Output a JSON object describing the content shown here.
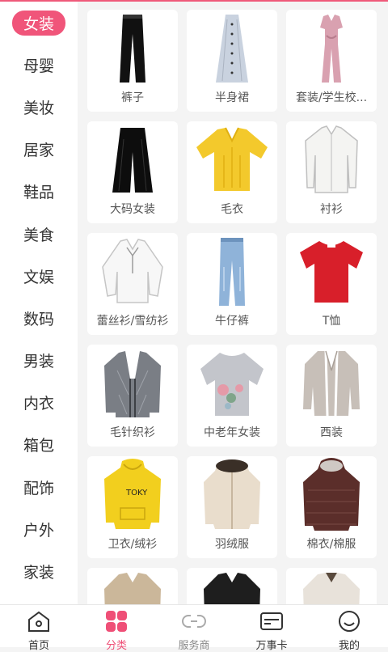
{
  "sidebar": {
    "items": [
      {
        "label": "女装",
        "active": true
      },
      {
        "label": "母婴"
      },
      {
        "label": "美妆"
      },
      {
        "label": "居家"
      },
      {
        "label": "鞋品"
      },
      {
        "label": "美食"
      },
      {
        "label": "文娱"
      },
      {
        "label": "数码"
      },
      {
        "label": "男装"
      },
      {
        "label": "内衣"
      },
      {
        "label": "箱包"
      },
      {
        "label": "配饰"
      },
      {
        "label": "户外"
      },
      {
        "label": "家装"
      }
    ]
  },
  "grid": {
    "items": [
      {
        "label": "裤子",
        "icon": "pants-icon"
      },
      {
        "label": "半身裙",
        "icon": "skirt-icon"
      },
      {
        "label": "套装/学生校...",
        "icon": "jumpsuit-icon"
      },
      {
        "label": "大码女装",
        "icon": "wide-pants-icon"
      },
      {
        "label": "毛衣",
        "icon": "sweater-icon"
      },
      {
        "label": "衬衫",
        "icon": "shirt-icon"
      },
      {
        "label": "蕾丝衫/雪纺衫",
        "icon": "chiffon-blouse-icon"
      },
      {
        "label": "牛仔裤",
        "icon": "jeans-icon"
      },
      {
        "label": "T恤",
        "icon": "tshirt-icon"
      },
      {
        "label": "毛针织衫",
        "icon": "cardigan-icon"
      },
      {
        "label": "中老年女装",
        "icon": "floral-top-icon"
      },
      {
        "label": "西装",
        "icon": "blazer-icon"
      },
      {
        "label": "卫衣/绒衫",
        "icon": "hoodie-icon"
      },
      {
        "label": "羽绒服",
        "icon": "down-jacket-icon"
      },
      {
        "label": "棉衣/棉服",
        "icon": "padded-coat-icon"
      },
      {
        "label": "",
        "icon": "trench-coat-icon"
      },
      {
        "label": "",
        "icon": "leather-jacket-icon"
      },
      {
        "label": "",
        "icon": "fur-coat-icon"
      }
    ]
  },
  "tabbar": {
    "items": [
      {
        "label": "首页",
        "icon": "home-icon"
      },
      {
        "label": "分类",
        "icon": "category-icon",
        "active": true
      },
      {
        "label": "服务商",
        "icon": "link-icon"
      },
      {
        "label": "万事卡",
        "icon": "card-icon"
      },
      {
        "label": "我的",
        "icon": "smile-icon"
      }
    ]
  },
  "colors": {
    "accent": "#f0557a",
    "tab_active": "#ef4f77"
  }
}
